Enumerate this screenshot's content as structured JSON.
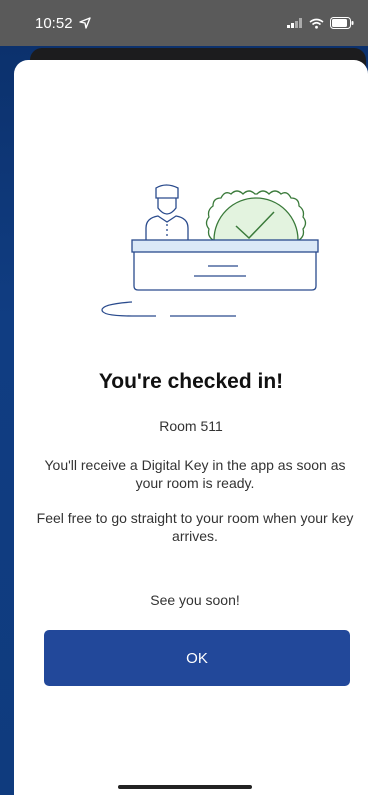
{
  "status_bar": {
    "time": "10:52"
  },
  "dialog": {
    "title": "You're checked in!",
    "room": "Room 511",
    "paragraph_1": "You'll receive a Digital Key in the app as soon as your room is ready.",
    "paragraph_2": "Feel free to go straight to your room when your key arrives.",
    "paragraph_3": "See you soon!",
    "ok_label": "OK"
  },
  "colors": {
    "button": "#22489a",
    "illustration_blue": "#2a4b8d",
    "illustration_green": "#3a7a3a",
    "badge_fill": "#e3f3df",
    "desk_fill": "#dbe9f7"
  },
  "icons": {
    "location_arrow": "location-arrow-icon",
    "signal": "signal-icon",
    "wifi": "wifi-icon",
    "battery": "battery-icon",
    "illustration": "front-desk-checkin-illustration"
  }
}
